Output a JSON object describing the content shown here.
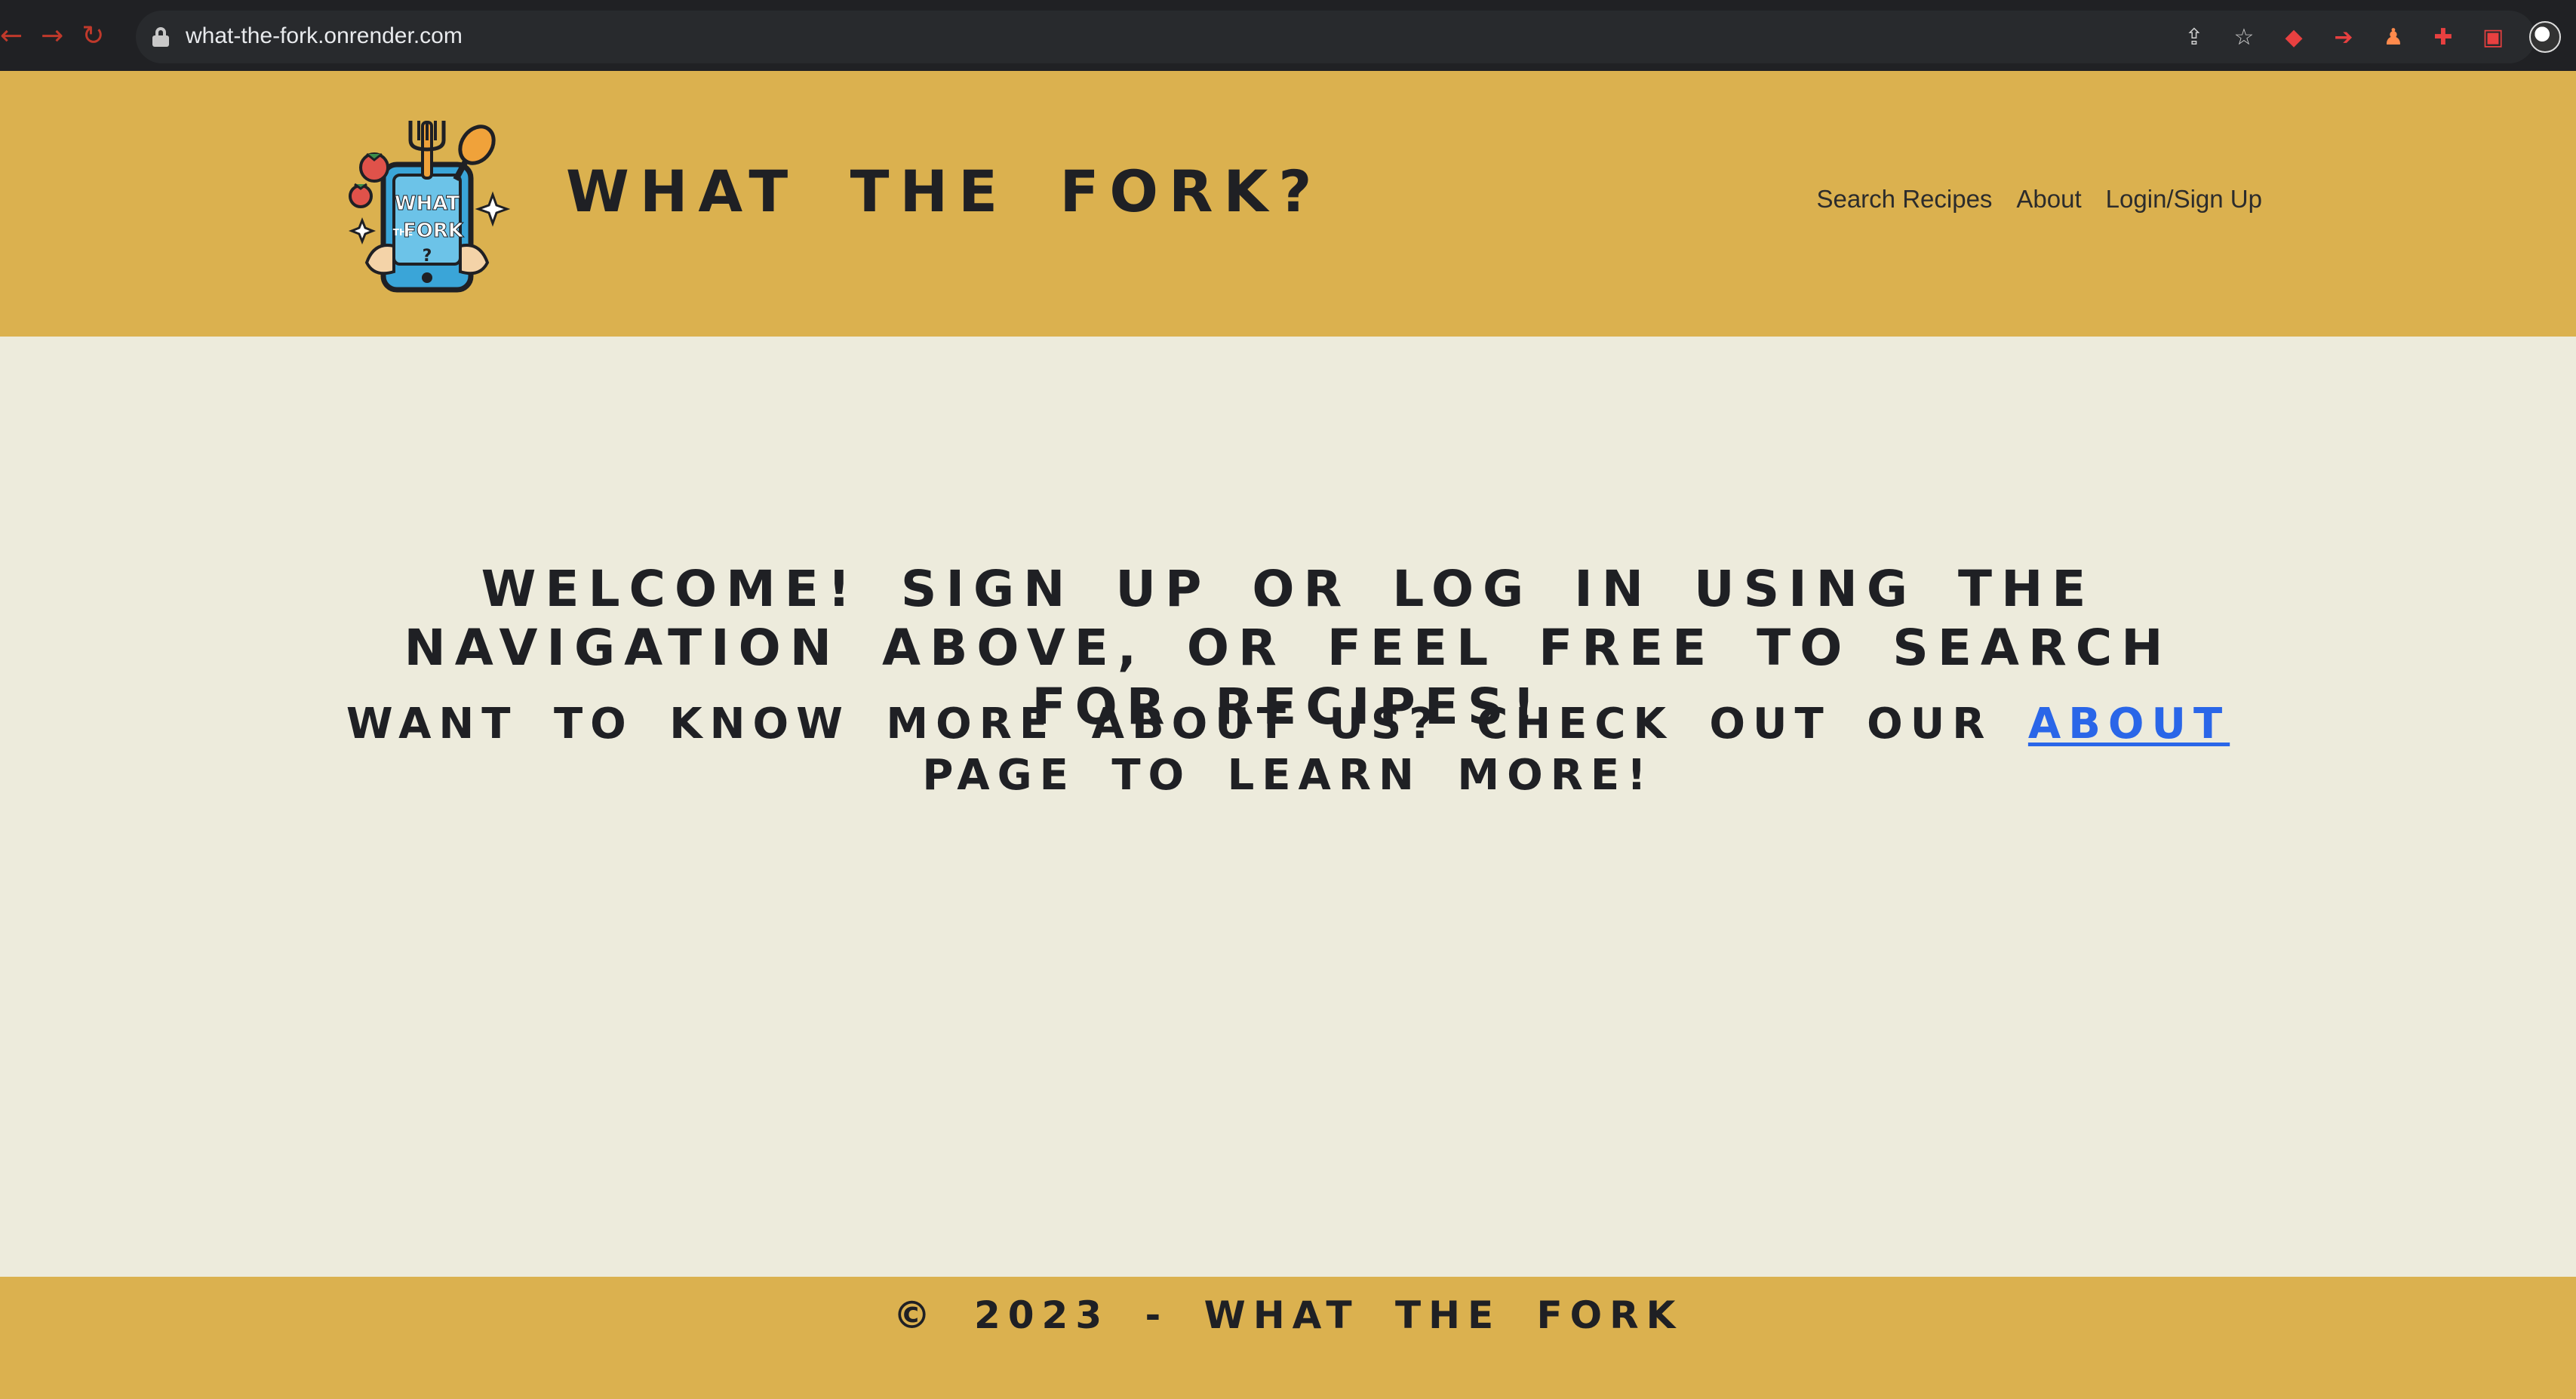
{
  "browser": {
    "url": "what-the-fork.onrender.com",
    "back_icon": "arrow-left-icon",
    "forward_icon": "arrow-right-icon",
    "reload_icon": "reload-icon"
  },
  "header": {
    "brand": "WHAT THE FORK?",
    "logo_text": [
      "WHAT",
      "THE",
      "FORK",
      "?"
    ],
    "nav": [
      "Search Recipes",
      "About",
      "Login/Sign Up"
    ]
  },
  "main": {
    "welcome": "WELCOME! SIGN UP OR LOG IN USING THE NAVIGATION ABOVE, OR FEEL FREE TO SEARCH FOR RECIPES!",
    "learn_before": "WANT TO KNOW MORE ABOUT US? CHECK OUT OUR ",
    "learn_link": "ABOUT",
    "learn_after": " PAGE TO LEARN MORE!"
  },
  "footer": {
    "copyright": "© 2023 - WHAT THE FORK"
  },
  "colors": {
    "header_bg": "#dbb14f",
    "page_bg": "#edebdc",
    "link": "#2a66e8",
    "text": "#1f2024"
  }
}
